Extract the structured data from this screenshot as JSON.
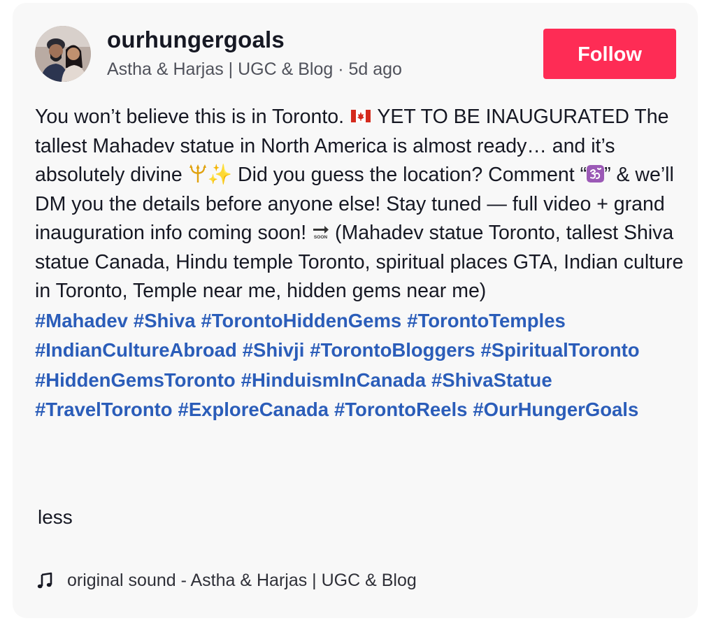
{
  "author": {
    "username": "ourhungergoals",
    "display_line": "Astha & Harjas | UGC & Blog · 5d ago",
    "avatar_icon": "profile-photo-avatar"
  },
  "follow_button": {
    "label": "Follow",
    "color": "#fe2c55"
  },
  "caption": {
    "t1": "You won’t believe this is in Toronto.",
    "flag_icon": "canada-flag-emoji",
    "t2": " YET TO BE INAUGURATED The tallest Mahadev statue in North America is almost ready… and it’s absolutely divine ",
    "trident_icon": "trident-emoji",
    "sparkle": "✨",
    "t3": " Did you guess the location? Comment “",
    "om_icon": "om-symbol-emoji",
    "t4": "” & we’ll DM you the details before anyone else! Stay tuned — full video + grand inauguration info coming soon! ",
    "soon_icon": "soon-arrow-emoji",
    "t5": " (Mahadev statue Toronto, tallest Shiva statue Canada, Hindu temple Toronto, spiritual places GTA, Indian culture in Toronto, Temple near me, hidden gems near me)",
    "hashtag_color": "#2b5db9",
    "hashtags": [
      "#Mahadev",
      "#Shiva",
      "#TorontoHiddenGems",
      "#TorontoTemples",
      "#IndianCultureAbroad",
      "#Shivji",
      "#TorontoBloggers",
      "#SpiritualToronto",
      "#HiddenGemsToronto",
      "#HinduismInCanada",
      "#ShivaStatue",
      "#TravelToronto",
      "#ExploreCanada",
      "#TorontoReels",
      "#OurHungerGoals"
    ]
  },
  "less_label": "less",
  "music": {
    "icon": "music-note-icon",
    "label": "original sound - Astha & Harjas | UGC & Blog"
  }
}
